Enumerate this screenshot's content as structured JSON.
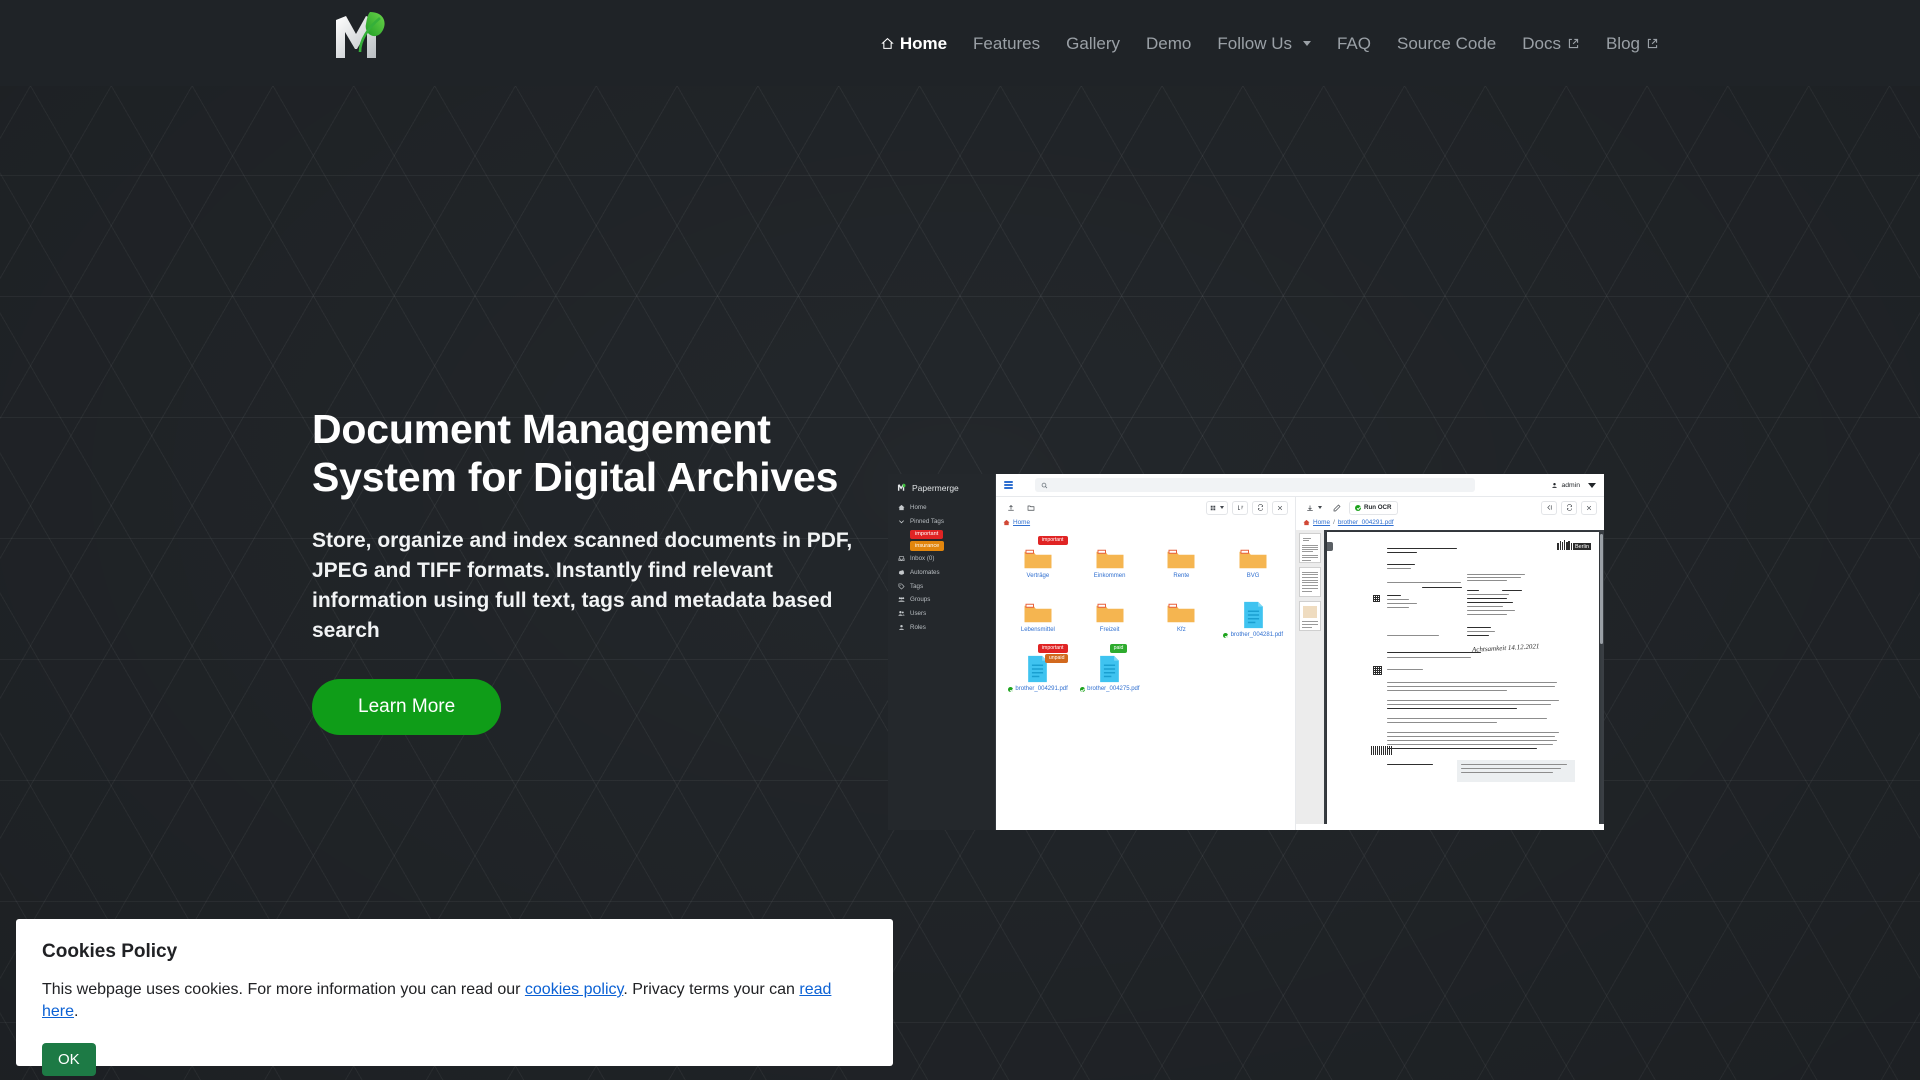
{
  "site": {
    "logo_name": "papermerge-logo",
    "accent_green": "#0f9d18",
    "background": "#23272b",
    "header_background": "#1f2327"
  },
  "nav": {
    "items": [
      {
        "label": "Home",
        "icon": "home-icon",
        "active": true,
        "external": false,
        "dropdown": false
      },
      {
        "label": "Features",
        "icon": "",
        "active": false,
        "external": false,
        "dropdown": false
      },
      {
        "label": "Gallery",
        "icon": "",
        "active": false,
        "external": false,
        "dropdown": false
      },
      {
        "label": "Demo",
        "icon": "",
        "active": false,
        "external": false,
        "dropdown": false
      },
      {
        "label": "Follow Us",
        "icon": "",
        "active": false,
        "external": false,
        "dropdown": true
      },
      {
        "label": "FAQ",
        "icon": "",
        "active": false,
        "external": false,
        "dropdown": false
      },
      {
        "label": "Source Code",
        "icon": "",
        "active": false,
        "external": false,
        "dropdown": false
      },
      {
        "label": "Docs",
        "icon": "external-link-icon",
        "active": false,
        "external": true,
        "dropdown": false
      },
      {
        "label": "Blog",
        "icon": "external-link-icon",
        "active": false,
        "external": true,
        "dropdown": false
      }
    ]
  },
  "hero": {
    "title": "Document Management System for Digital Archives",
    "subtitle": "Store, organize and index scanned documents in PDF, JPEG and TIFF formats. Instantly find relevant information using full text, tags and metadata based search",
    "cta_label": "Learn More"
  },
  "app_screenshot": {
    "sidebar": {
      "brand": "Papermerge",
      "items": [
        {
          "label": "Home",
          "icon": "home-icon"
        },
        {
          "label": "Pinned Tags",
          "icon": "chevron-down-icon"
        },
        {
          "label": "Inbox (0)",
          "icon": "inbox-icon"
        },
        {
          "label": "Automates",
          "icon": "automates-icon"
        },
        {
          "label": "Tags",
          "icon": "tag-icon"
        },
        {
          "label": "Groups",
          "icon": "groups-icon"
        },
        {
          "label": "Users",
          "icon": "users-icon"
        },
        {
          "label": "Roles",
          "icon": "role-icon"
        }
      ],
      "pinned_tags": [
        {
          "label": "important",
          "color": "#e02424"
        },
        {
          "label": "insurance",
          "color": "#e2860d"
        }
      ]
    },
    "topbar": {
      "search_placeholder": "",
      "search_value": "",
      "user": "admin"
    },
    "left_pane": {
      "breadcrumb": [
        "Home"
      ],
      "toolbar": [
        "upload-icon",
        "new-folder-icon",
        "view-mode-icon",
        "sort-icon",
        "refresh-icon",
        "close-icon"
      ],
      "items": [
        {
          "name": "Verträge",
          "type": "folder",
          "tags": [
            {
              "label": "important",
              "color": "#e02424"
            }
          ]
        },
        {
          "name": "Einkommen",
          "type": "folder",
          "tags": []
        },
        {
          "name": "Rente",
          "type": "folder",
          "tags": []
        },
        {
          "name": "BVG",
          "type": "folder",
          "tags": []
        },
        {
          "name": "Lebensmittel",
          "type": "folder",
          "tags": []
        },
        {
          "name": "Freizeit",
          "type": "folder",
          "tags": []
        },
        {
          "name": "Kfz",
          "type": "folder",
          "tags": []
        },
        {
          "name": "brother_004281.pdf",
          "type": "document",
          "tags": []
        },
        {
          "name": "brother_004291.pdf",
          "type": "document",
          "tags": [
            {
              "label": "important",
              "color": "#e02424"
            },
            {
              "label": "unpaid",
              "color": "#d2691e"
            }
          ]
        },
        {
          "name": "brother_004275.pdf",
          "type": "document",
          "tags": [
            {
              "label": "paid",
              "color": "#2eab2e"
            }
          ]
        }
      ]
    },
    "right_pane": {
      "toolbar": [
        "download-icon",
        "edit-icon"
      ],
      "ocr_label": "Run OCR",
      "right_toolbar": [
        "panel-icon",
        "refresh-icon",
        "close-icon"
      ],
      "breadcrumb": [
        "Home",
        "brother_004291.pdf"
      ],
      "document": {
        "issuer": "Der Polizeipräsident in Berlin",
        "department": "Bußgeldstelle",
        "address_label": "Postanschrift",
        "address": "10997 Berlin",
        "sender_line": "Der Polizeipräsident in Berlin, 10997 Berlin",
        "case_number": "58.71.550132.3",
        "recipient_title": "Herrn",
        "recipient_name": "Eugen Ciur",
        "recipient_street": "Lobenberger Str. 4",
        "recipient_city": "10315 Berlin",
        "date_label": "Datum",
        "date": "11.11.2021",
        "ref_label": "Aktenzeichen",
        "ref": "58.71.550132.3",
        "ref_note": "Bitte stets angeben",
        "birth_line": "geboren am 27.06.1983 in MDA",
        "subject": "Schriftliche Verwarnung mit Verwarnungsgeld / Anhörung",
        "subject_note": "Verwarnungen werden nicht im Fahreignungsregister eingetragen.",
        "salutation": "Sehr geehrter Herr Ciur,",
        "logo": "Berlin",
        "handwritten_note": "Achtsamkeit 14.12.2021"
      }
    }
  },
  "cookies": {
    "title": "Cookies Policy",
    "text_before": "This webpage uses cookies. For more information you can read our ",
    "link1": "cookies policy",
    "text_middle": ". Privacy terms your can ",
    "link2": "read here",
    "text_after": ".",
    "ok_label": "OK"
  }
}
